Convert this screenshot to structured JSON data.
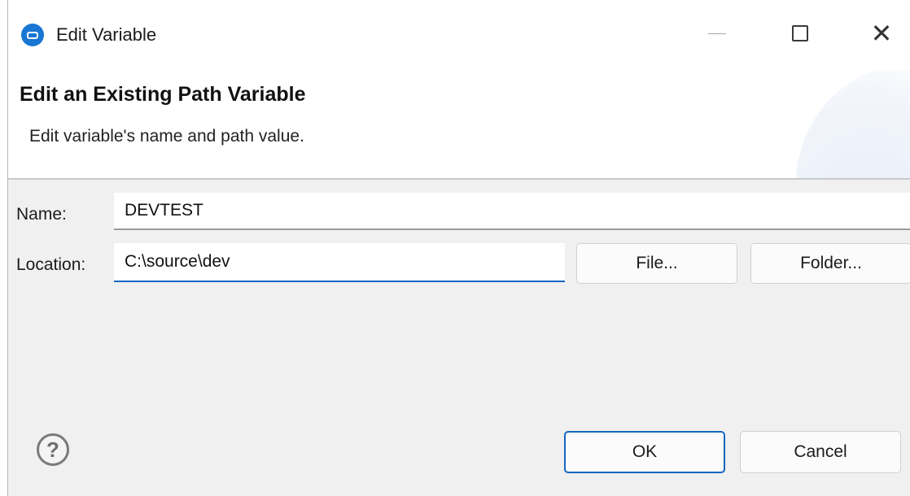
{
  "window": {
    "title": "Edit Variable",
    "icon": "eclipse-app-icon"
  },
  "title_buttons": {
    "minimize_icon": "minimize-icon",
    "maximize_icon": "maximize-icon",
    "close_icon": "close-icon",
    "close_glyph": "✕"
  },
  "banner": {
    "title": "Edit an Existing Path Variable",
    "description": "Edit variable's name and path value."
  },
  "form": {
    "name_label": "Name:",
    "name_value": "DEVTEST",
    "location_label": "Location:",
    "location_value": "C:\\source\\dev"
  },
  "buttons": {
    "file": "File...",
    "folder": "Folder...",
    "ok": "OK",
    "cancel": "Cancel"
  },
  "help": {
    "icon": "help-icon",
    "glyph": "?"
  },
  "colors": {
    "accent": "#1565c0",
    "dialog_bg": "#f0f0f0"
  }
}
